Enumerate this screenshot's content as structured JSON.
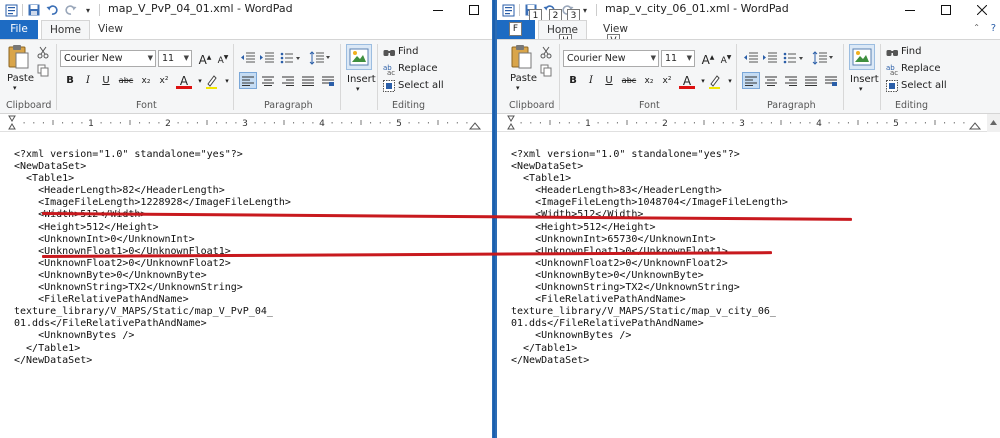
{
  "colors": {
    "accent": "#1d6bc3",
    "annotation": "#c8191e",
    "divider": "#2b6cb5"
  },
  "ribbon": {
    "tab_file": "File",
    "tab_home": "Home",
    "tab_view": "View",
    "paste": "Paste",
    "clipboard": "Clipboard",
    "font_name": "Courier New",
    "font_size": "11",
    "font_group": "Font",
    "paragraph_group": "Paragraph",
    "insert": "Insert",
    "find": "Find",
    "replace": "Replace",
    "select_all": "Select all",
    "editing_group": "Editing",
    "bold": "B",
    "italic": "I",
    "underline": "U",
    "strike": "abc",
    "sub": "x₂",
    "sup": "x²",
    "font_color": "A",
    "grow": "A",
    "shrink": "A"
  },
  "ruler_labels": [
    "1",
    "2",
    "3",
    "4",
    "5"
  ],
  "keytips": {
    "file": "F",
    "save": "1",
    "undo": "2",
    "redo": "3",
    "home": "H",
    "view": "V"
  },
  "left": {
    "title": "map_V_PvP_04_01.xml - WordPad",
    "lines": [
      "<?xml version=\"1.0\" standalone=\"yes\"?>",
      "<NewDataSet>",
      "  <Table1>",
      "    <HeaderLength>82</HeaderLength>",
      "    <ImageFileLength>1228928</ImageFileLength>",
      "    <Width>512</Width>",
      "    <Height>512</Height>",
      "    <UnknownInt>0</UnknownInt>",
      "    <UnknownFloat1>0</UnknownFloat1>",
      "    <UnknownFloat2>0</UnknownFloat2>",
      "    <UnknownByte>0</UnknownByte>",
      "    <UnknownString>TX2</UnknownString>",
      "    <FileRelativePathAndName>",
      "texture_library/V_MAPS/Static/map_V_PvP_04_",
      "01.dds</FileRelativePathAndName>",
      "    <UnknownBytes />",
      "  </Table1>",
      "</NewDataSet>"
    ]
  },
  "right": {
    "title": "map_v_city_06_01.xml - WordPad",
    "lines": [
      "<?xml version=\"1.0\" standalone=\"yes\"?>",
      "<NewDataSet>",
      "  <Table1>",
      "    <HeaderLength>83</HeaderLength>",
      "    <ImageFileLength>1048704</ImageFileLength>",
      "    <Width>512</Width>",
      "    <Height>512</Height>",
      "    <UnknownInt>65730</UnknownInt>",
      "    <UnknownFloat1>0</UnknownFloat1>",
      "    <UnknownFloat2>0</UnknownFloat2>",
      "    <UnknownByte>0</UnknownByte>",
      "    <UnknownString>TX2</UnknownString>",
      "    <FileRelativePathAndName>",
      "texture_library/V_MAPS/Static/map_v_city_06_",
      "01.dds</FileRelativePathAndName>",
      "    <UnknownBytes />",
      "  </Table1>",
      "</NewDataSet>"
    ]
  }
}
